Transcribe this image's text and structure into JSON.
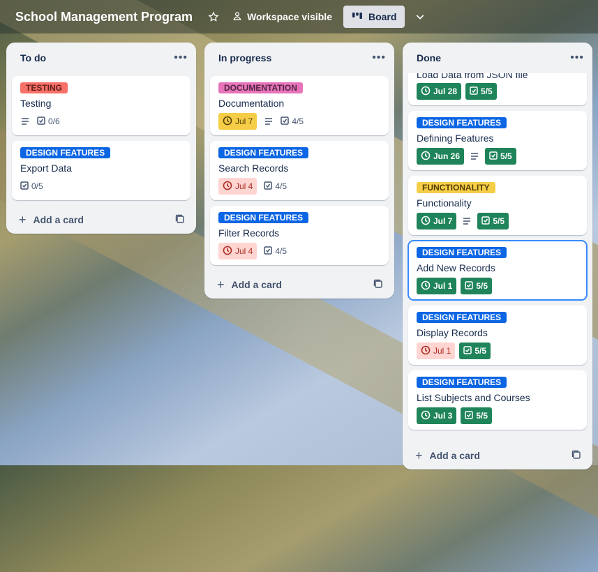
{
  "header": {
    "board_title": "School Management Program",
    "workspace_label": "Workspace visible",
    "view_label": "Board"
  },
  "lists": [
    {
      "title": "To do",
      "add_card": "Add a card",
      "cards": [
        {
          "label": "TESTING",
          "label_color": "#f87168",
          "title": "Testing",
          "has_description": true,
          "checklist": "0/6"
        },
        {
          "label": "DESIGN FEATURES",
          "label_color": "#0c66e4",
          "title": "Export Data",
          "checklist": "0/5"
        }
      ]
    },
    {
      "title": "In progress",
      "add_card": "Add a card",
      "cards": [
        {
          "label": "DOCUMENTATION",
          "label_color": "#e774bb",
          "title": "Documentation",
          "due": "Jul 7",
          "due_status": "due-soon",
          "has_description": true,
          "checklist": "4/5"
        },
        {
          "label": "DESIGN FEATURES",
          "label_color": "#0c66e4",
          "title": "Search Records",
          "due": "Jul 4",
          "due_status": "overdue",
          "checklist": "4/5"
        },
        {
          "label": "DESIGN FEATURES",
          "label_color": "#0c66e4",
          "title": "Filter Records",
          "due": "Jul 4",
          "due_status": "overdue",
          "checklist": "4/5"
        }
      ]
    },
    {
      "title": "Done",
      "add_card": "Add a card",
      "cards": [
        {
          "title": "Load Data from JSON file",
          "due": "Jul 28",
          "due_status": "complete",
          "checklist": "5/5"
        },
        {
          "label": "DESIGN FEATURES",
          "label_color": "#0c66e4",
          "title": "Defining Features",
          "due": "Jun 26",
          "due_status": "complete",
          "has_description": true,
          "checklist": "5/5"
        },
        {
          "label": "FUNCTIONALITY",
          "label_color": "#f5cd47",
          "title": "Functionality",
          "due": "Jul 7",
          "due_status": "complete",
          "has_description": true,
          "checklist": "5/5"
        },
        {
          "label": "DESIGN FEATURES",
          "label_color": "#0c66e4",
          "title": "Add New Records",
          "due": "Jul 1",
          "due_status": "complete",
          "checklist": "5/5",
          "selected": true
        },
        {
          "label": "DESIGN FEATURES",
          "label_color": "#0c66e4",
          "title": "Display Records",
          "due": "Jul 1",
          "due_status": "overdue",
          "checklist": "5/5"
        },
        {
          "label": "DESIGN FEATURES",
          "label_color": "#0c66e4",
          "title": "List Subjects and Courses",
          "due": "Jul 3",
          "due_status": "complete",
          "checklist": "5/5"
        }
      ]
    }
  ]
}
